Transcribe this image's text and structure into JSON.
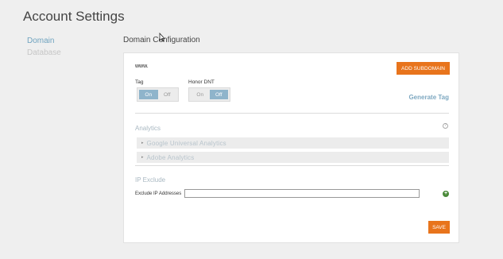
{
  "page": {
    "title": "Account Settings"
  },
  "nav": {
    "items": [
      {
        "label": "Domain",
        "active": true
      },
      {
        "label": "Database",
        "active": false
      }
    ]
  },
  "section": {
    "title": "Domain Configuration"
  },
  "domain": {
    "prefix": "www.",
    "add_subdomain_label": "ADD SUBDOMAIN",
    "tag": {
      "label": "Tag",
      "on_label": "On",
      "off_label": "Off",
      "selected": "On"
    },
    "honor_dnt": {
      "label": "Honor DNT",
      "on_label": "On",
      "off_label": "Off",
      "selected": "Off"
    },
    "generate_tag_label": "Generate Tag"
  },
  "analytics": {
    "label": "Analytics",
    "help_icon": "question-circle-icon",
    "items": [
      {
        "label": "Google Universal Analytics"
      },
      {
        "label": "Adobe Analytics"
      }
    ]
  },
  "ip_exclude": {
    "label": "IP Exclude",
    "field_label": "Exclude IP Addresses",
    "value": "",
    "add_icon": "plus-circle-icon"
  },
  "actions": {
    "save_label": "SAVE"
  },
  "colors": {
    "accent_orange": "#e8741c",
    "accent_blue": "#6fa3bf",
    "add_green": "#4a8a3a"
  }
}
